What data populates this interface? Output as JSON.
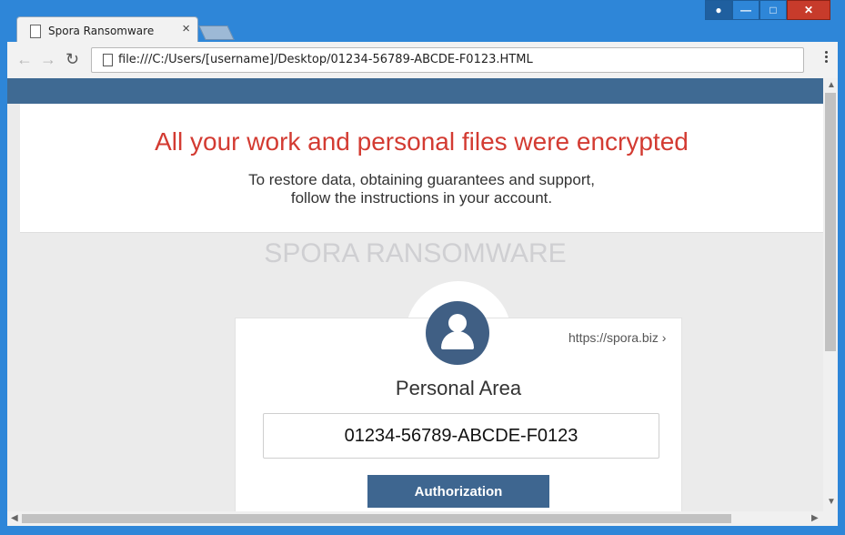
{
  "browser": {
    "tab_title": "Spora Ransomware",
    "tab_close": "×",
    "url": "file:///C:/Users/[username]/Desktop/01234-56789-ABCDE-F0123.HTML",
    "back": "←",
    "forward": "→",
    "reload": "↻",
    "window_minimize": "—",
    "window_maximize": "□",
    "window_close": "✕"
  },
  "page": {
    "headline": "All your work and personal files were encrypted",
    "subtext_line1": "To restore data, obtaining guarantees and support,",
    "subtext_line2": "follow the instructions in your account.",
    "brand": "SPORA RANSOMWARE",
    "card": {
      "link": "https://spora.biz ›",
      "title": "Personal Area",
      "code": "01234-56789-ABCDE-F0123",
      "button": "Authorization"
    }
  },
  "icons": [
    "page-icon",
    "new-tab-icon",
    "user-icon",
    "menu-icon",
    "avatar-icon",
    "scroll-up-icon",
    "scroll-down-icon",
    "scroll-left-icon",
    "scroll-right-icon"
  ],
  "colors": {
    "accent_red": "#d33b32",
    "header_blue": "#3f6a93",
    "button_blue": "#3e6690"
  }
}
